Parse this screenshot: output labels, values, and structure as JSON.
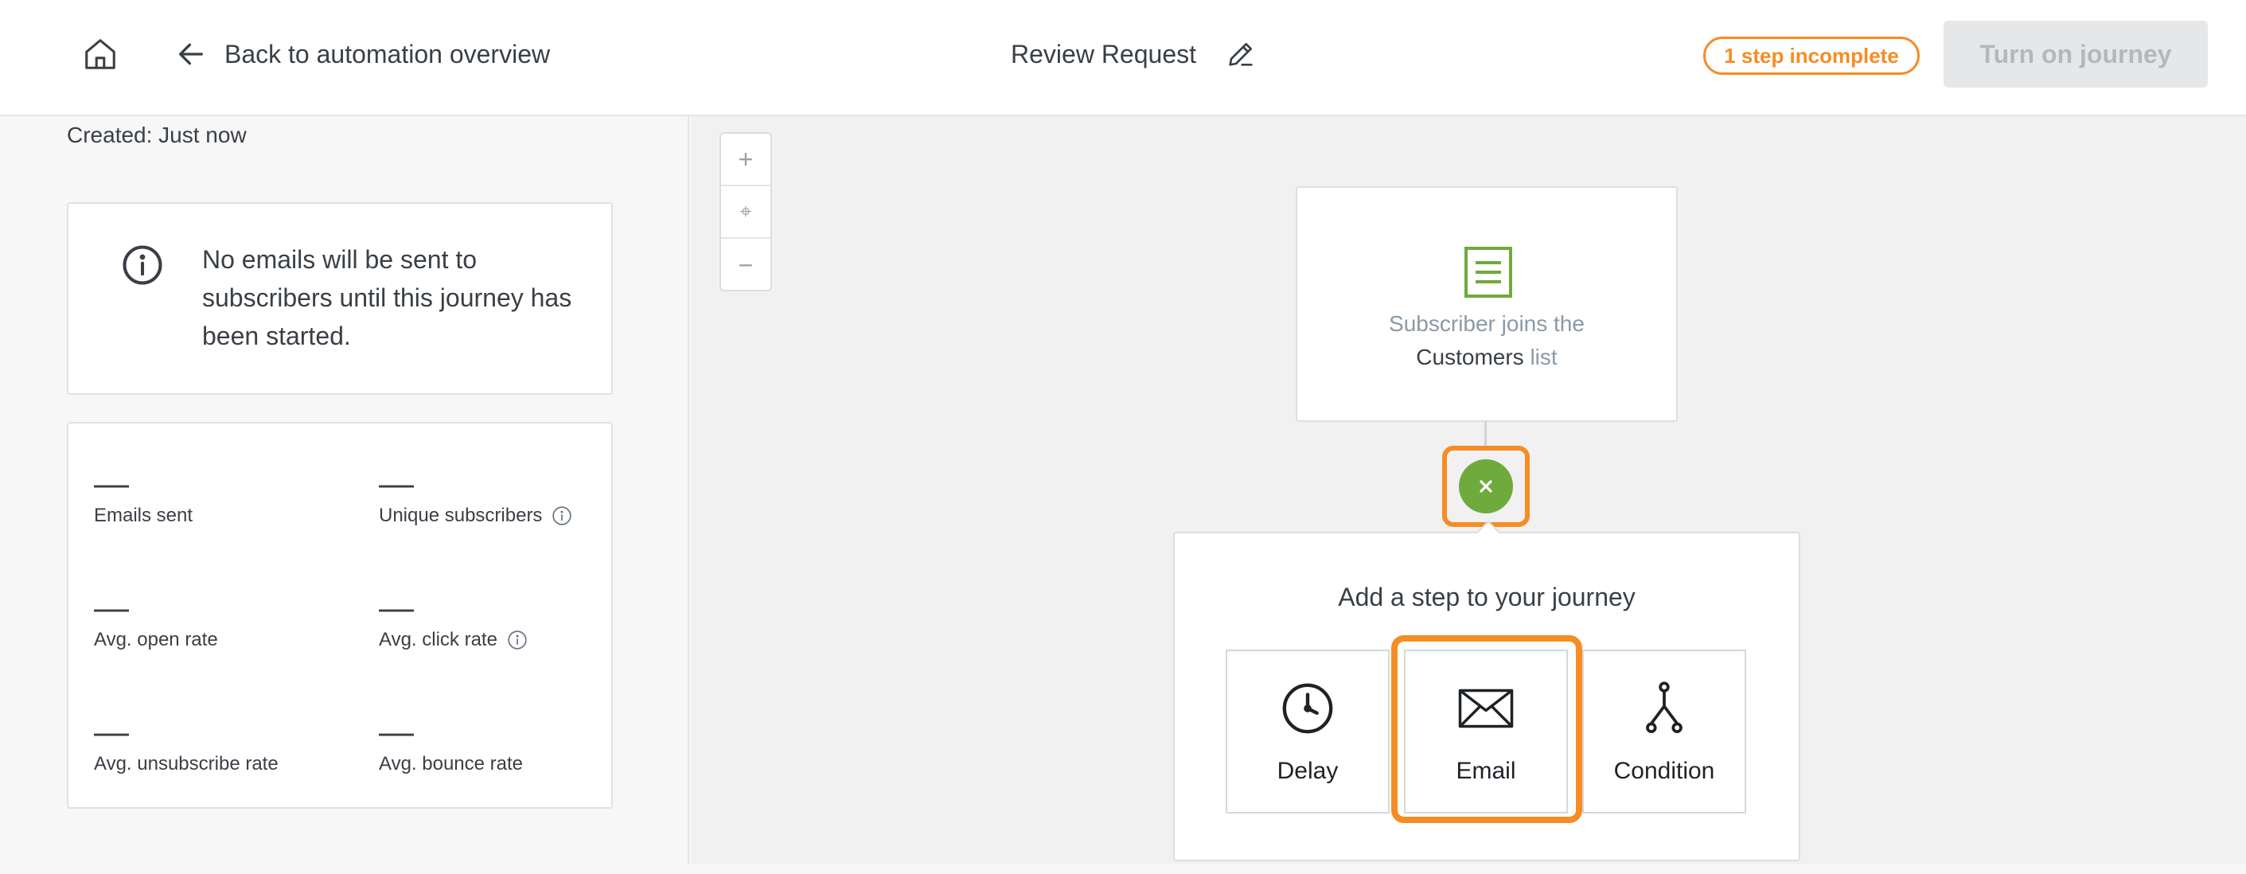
{
  "header": {
    "back_label": "Back to automation overview",
    "journey_title": "Review Request",
    "status_badge": "1 step incomplete",
    "turn_on_label": "Turn on journey"
  },
  "sidebar": {
    "created": "Created: Just now",
    "info_message": "No emails will be sent to subscribers until this journey has been started.",
    "stats": [
      {
        "value": "—",
        "label": "Emails sent"
      },
      {
        "value": "—",
        "label": "Unique subscribers"
      },
      {
        "value": "—",
        "label": "Avg. open rate"
      },
      {
        "value": "—",
        "label": "Avg. click rate"
      },
      {
        "value": "—",
        "label": "Avg. unsubscribe rate"
      },
      {
        "value": "—",
        "label": "Avg. bounce rate"
      }
    ]
  },
  "canvas": {
    "zoom": {
      "in": "+",
      "center": "⌖",
      "out": "−"
    },
    "trigger": {
      "line1": "Subscriber joins the",
      "list_name": "Customers",
      "list_suffix": "list"
    },
    "add_step": {
      "heading": "Add a step to your journey",
      "options": [
        {
          "label": "Delay",
          "icon": "clock-icon"
        },
        {
          "label": "Email",
          "icon": "envelope-icon"
        },
        {
          "label": "Condition",
          "icon": "branch-icon"
        }
      ]
    }
  },
  "colors": {
    "accent": "#f68c24",
    "trigger_green": "#6faa3d",
    "muted_text": "#8a9aa8"
  }
}
